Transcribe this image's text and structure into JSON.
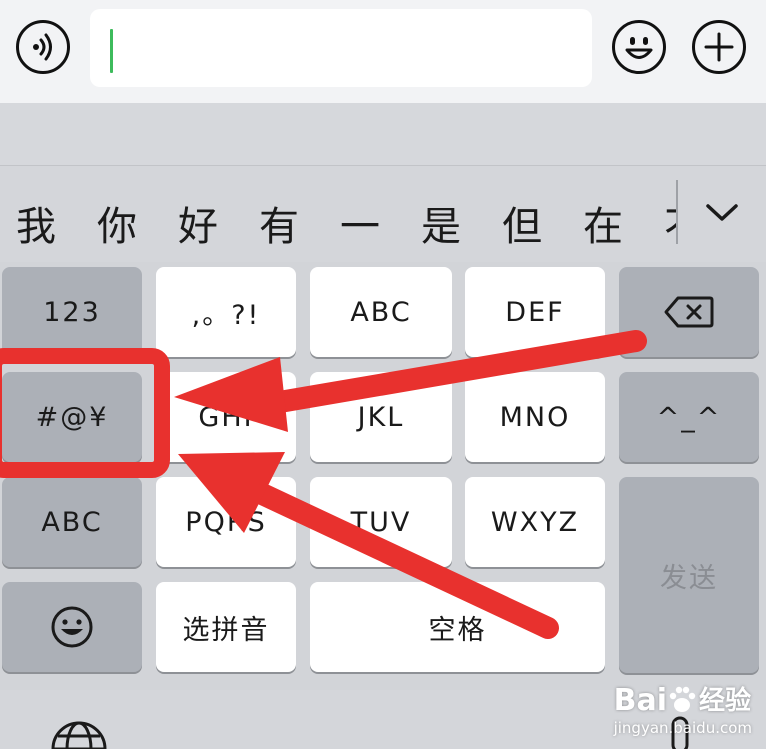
{
  "candidates": [
    "我",
    "你",
    "好",
    "有",
    "一",
    "是",
    "但",
    "在",
    "不"
  ],
  "keys": {
    "numbers": "123",
    "punct": ",。?!",
    "abc_letters": "ABC",
    "def_letters": "DEF",
    "symbols": "#@¥",
    "ghi_letters": "GHI",
    "jkl_letters": "JKL",
    "mno_letters": "MNO",
    "kaomoji": "^_^",
    "abc_mode": "ABC",
    "pqrs_letters": "PQRS",
    "tuv_letters": "TUV",
    "wxyz_letters": "WXYZ",
    "send": "发送",
    "pinyin_select": "选拼音",
    "space": "空格"
  },
  "watermark": {
    "brand": "Bai",
    "brand_suffix": "经验",
    "url": "jingyan.baidu.com"
  },
  "colors": {
    "caret": "#3dbb5c",
    "annotation": "#e8312e",
    "light_key": "#ffffff",
    "dark_key": "#acb0b7"
  }
}
